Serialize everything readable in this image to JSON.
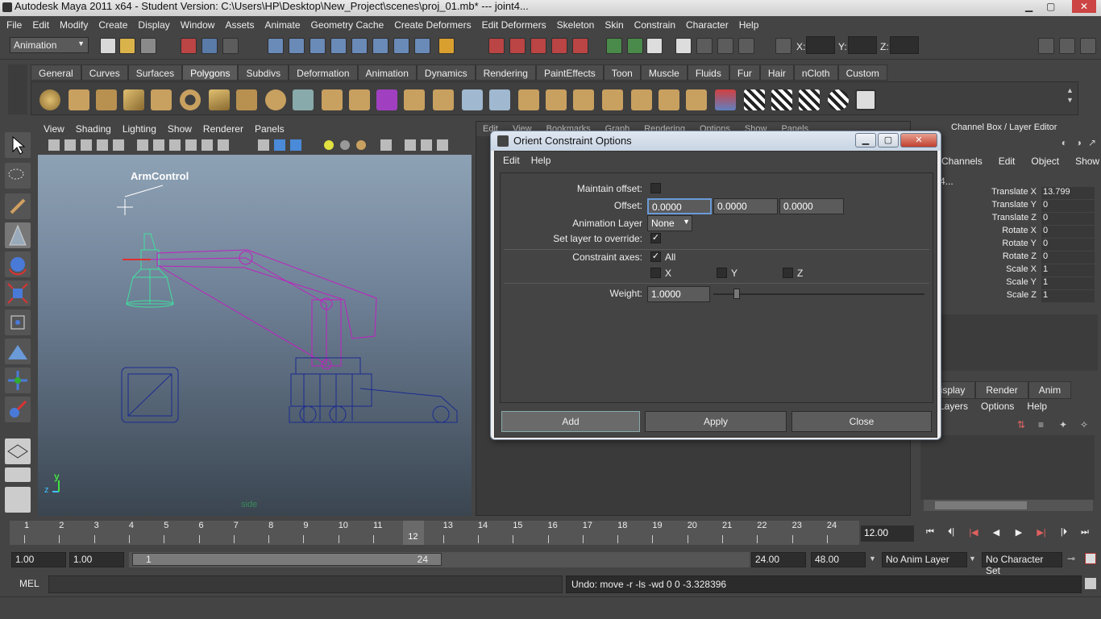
{
  "window": {
    "title": "Autodesk Maya 2011 x64 - Student Version: C:\\Users\\HP\\Desktop\\New_Project\\scenes\\proj_01.mb*   ---   joint4..."
  },
  "menubar": [
    "File",
    "Edit",
    "Modify",
    "Create",
    "Display",
    "Window",
    "Assets",
    "Animate",
    "Geometry Cache",
    "Create Deformers",
    "Edit Deformers",
    "Skeleton",
    "Skin",
    "Constrain",
    "Character",
    "Help"
  ],
  "status": {
    "mode": "Animation",
    "x_label": "X:",
    "y_label": "Y:",
    "z_label": "Z:"
  },
  "shelf_tabs": [
    "General",
    "Curves",
    "Surfaces",
    "Polygons",
    "Subdivs",
    "Deformation",
    "Animation",
    "Dynamics",
    "Rendering",
    "PaintEffects",
    "Toon",
    "Muscle",
    "Fluids",
    "Fur",
    "Hair",
    "nCloth",
    "Custom"
  ],
  "shelf_active": "Polygons",
  "viewport": {
    "menus": [
      "View",
      "Shading",
      "Lighting",
      "Show",
      "Renderer",
      "Panels"
    ],
    "annotation": "ArmControl",
    "camera_label": "side",
    "axis_y": "y",
    "axis_z": "z"
  },
  "viewport2": {
    "menus": [
      "Edit",
      "View",
      "Bookmarks",
      "Graph",
      "Rendering",
      "Options",
      "Show",
      "Panels"
    ]
  },
  "channel_box": {
    "title": "Channel Box / Layer Editor",
    "menus": [
      "Channels",
      "Edit",
      "Object",
      "Show"
    ],
    "object": "joint4...",
    "channels": [
      {
        "label": "Translate X",
        "value": "13.799"
      },
      {
        "label": "Translate Y",
        "value": "0"
      },
      {
        "label": "Translate Z",
        "value": "0"
      },
      {
        "label": "Rotate X",
        "value": "0"
      },
      {
        "label": "Rotate Y",
        "value": "0"
      },
      {
        "label": "Rotate Z",
        "value": "0"
      },
      {
        "label": "Scale X",
        "value": "1"
      },
      {
        "label": "Scale Y",
        "value": "1"
      },
      {
        "label": "Scale Z",
        "value": "1"
      }
    ],
    "layer_tabs": [
      "Display",
      "Render",
      "Anim"
    ],
    "layer_menus": [
      "Layers",
      "Options",
      "Help"
    ]
  },
  "dialog": {
    "title": "Orient Constraint Options",
    "menus": [
      "Edit",
      "Help"
    ],
    "maintain_offset_label": "Maintain offset:",
    "offset_label": "Offset:",
    "offset_x": "0.0000",
    "offset_y": "0.0000",
    "offset_z": "0.0000",
    "anim_layer_label": "Animation Layer",
    "anim_layer_value": "None",
    "set_layer_label": "Set layer to override:",
    "constraint_axes_label": "Constraint axes:",
    "axis_all": "All",
    "axis_x": "X",
    "axis_y": "Y",
    "axis_z": "Z",
    "weight_label": "Weight:",
    "weight_value": "1.0000",
    "weight_fraction": 1.0,
    "add_label": "Add",
    "apply_label": "Apply",
    "close_label": "Close"
  },
  "timeline": {
    "ticks": [
      "1",
      "2",
      "3",
      "4",
      "5",
      "6",
      "7",
      "8",
      "9",
      "10",
      "11",
      "12",
      "13",
      "14",
      "15",
      "16",
      "17",
      "18",
      "19",
      "20",
      "21",
      "22",
      "23",
      "24"
    ],
    "current_frame": "12",
    "current_frame_field": "12.00"
  },
  "range": {
    "start": "1.00",
    "playback_start": "1.00",
    "slider_start": "1",
    "slider_end": "24",
    "playback_end": "24.00",
    "end": "48.00",
    "anim_layer": "No Anim Layer",
    "char_set": "No Character Set"
  },
  "command": {
    "label": "MEL",
    "result": "Undo: move -r -ls -wd 0 0 -3.328396"
  }
}
